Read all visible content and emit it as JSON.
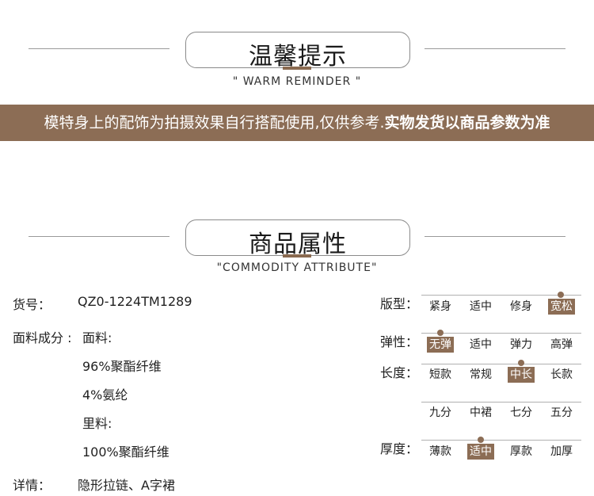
{
  "reminder": {
    "title": "温馨提示",
    "subtitle": "\" WARM REMINDER \"",
    "banner_normal": "模特身上的配饰为拍摄效果自行搭配使用,仅供参考.",
    "banner_bold": "实物发货以商品参数为准"
  },
  "attribute": {
    "title": "商品属性",
    "subtitle": "\"COMMODITY ATTRIBUTE\""
  },
  "details": {
    "item_no_label": "货号：",
    "item_no_value": "QZ0-1224TM1289",
    "fabric_label": "面料成分 :",
    "fabric_lines": [
      "面料:",
      "96%聚酯纤维",
      "4%氨纶",
      "里料:",
      "100%聚酯纤维"
    ],
    "detail_label": "详情：",
    "detail_value": "隐形拉链、A字裙"
  },
  "specs": {
    "fit": {
      "label": "版型：",
      "options": [
        "紧身",
        "适中",
        "修身",
        "宽松"
      ],
      "selected": "宽松"
    },
    "elasticity": {
      "label": "弹性：",
      "options": [
        "无弹",
        "适中",
        "弹力",
        "高弹"
      ],
      "selected": "无弹"
    },
    "length": {
      "label": "长度：",
      "options": [
        "短款",
        "常规",
        "中长",
        "长款"
      ],
      "options2": [
        "九分",
        "中裙",
        "七分",
        "五分"
      ],
      "selected": "中长"
    },
    "thickness": {
      "label": "厚度：",
      "options": [
        "薄款",
        "适中",
        "厚款",
        "加厚"
      ],
      "selected": "适中"
    }
  },
  "colors": {
    "accent": "#8c6d55",
    "line": "#9a9a9a"
  }
}
